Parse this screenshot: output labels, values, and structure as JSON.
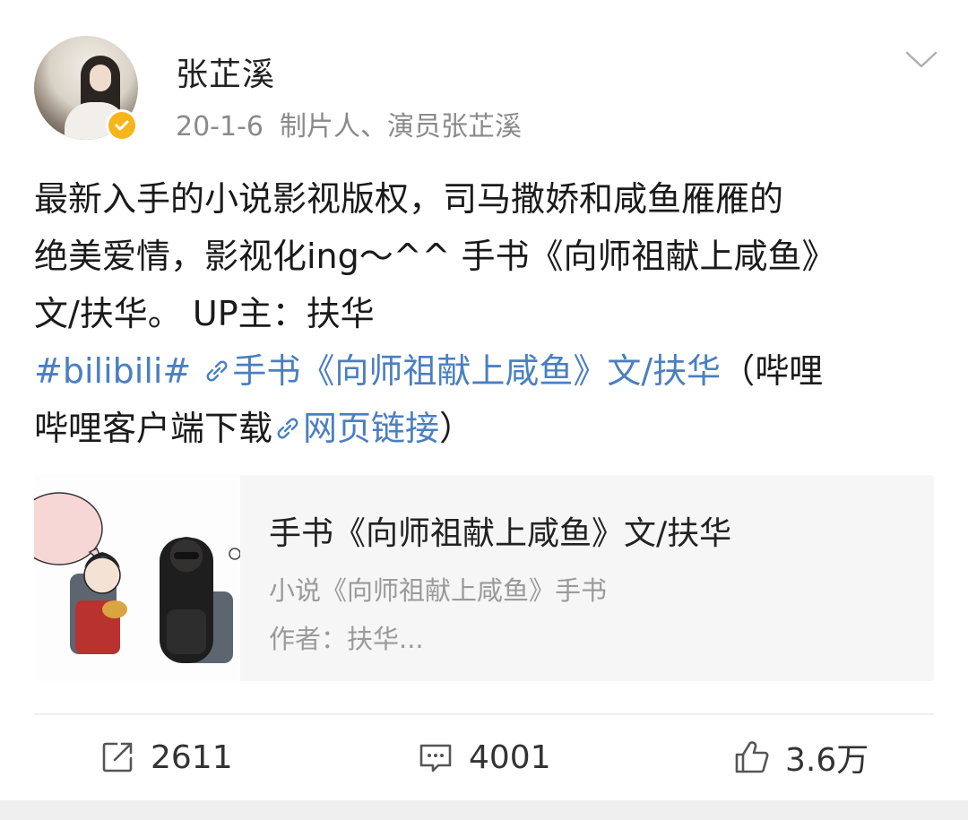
{
  "post": {
    "author": "张芷溪",
    "date": "20-1-6",
    "source": "制片人、演员张芷溪",
    "text_line1": "最新入手的小说影视版权，司马撒娇和咸鱼雁雁的",
    "text_line2": "绝美爱情，影视化ing～^^ 手书《向师祖献上咸鱼》",
    "text_line3": "文/扶华。 UP主：扶华",
    "hashtag": "#bilibili#",
    "link1_text": "手书《向师祖献上咸鱼》文/扶华",
    "paren_open_text": "（哔哩",
    "paren_text_line2": "哔哩客户端下载",
    "link2_text": "网页链接",
    "paren_close": "）"
  },
  "card": {
    "title": "手书《向师祖献上咸鱼》文/扶华",
    "subtitle": "小说《向师祖献上咸鱼》手书",
    "author": "作者：扶华..."
  },
  "actions": {
    "repost_count": "2611",
    "comment_count": "4001",
    "like_count": "3.6万"
  },
  "icons": {
    "chevron": "chevron-down-icon",
    "verified": "verified-badge-icon",
    "link": "link-icon",
    "repost": "repost-icon",
    "comment": "comment-icon",
    "like": "thumbs-up-icon"
  },
  "colors": {
    "link": "#4a7fc1",
    "verified": "#f5b51b",
    "meta_gray": "#8a8a8a"
  }
}
